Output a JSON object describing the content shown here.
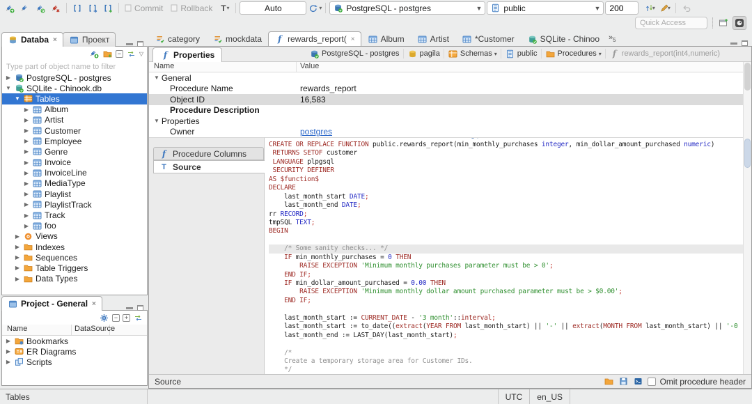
{
  "window": {
    "quick_access_placeholder": "Quick Access"
  },
  "toolbar": {
    "left_icons": [
      "new-connection-plug-icon",
      "connect-plug-icon",
      "reconnect-plug-icon",
      "disconnect-plug-icon",
      "|",
      "sql-editor-icon",
      "recent-sql-editor-icon",
      "new-sql-editor-icon",
      "|"
    ],
    "commit": "Commit",
    "rollback": "Rollback",
    "tx_log": "T",
    "tx_mode": "Auto",
    "connection": "PostgreSQL - postgres",
    "schema": "public",
    "row_limit": "200",
    "right_icons": [
      "fetch-size-sync-icon",
      "brush-icon",
      "|",
      "undo-icon"
    ]
  },
  "navigator": {
    "tab_database": "Databa",
    "tab_project": "Проект",
    "filter_placeholder": "Type part of object name to filter",
    "tree": [
      {
        "indent": 0,
        "exp": "collapsed",
        "icon": "postgres-db-icon",
        "label": "PostgreSQL - postgres"
      },
      {
        "indent": 0,
        "exp": "expanded",
        "icon": "sqlite-db-icon",
        "label": "SQLite - Chinook.db"
      },
      {
        "indent": 1,
        "exp": "expanded",
        "icon": "tables-folder-icon",
        "label": "Tables",
        "selected": true
      },
      {
        "indent": 2,
        "exp": "collapsed",
        "icon": "table-icon",
        "label": "Album"
      },
      {
        "indent": 2,
        "exp": "collapsed",
        "icon": "table-icon",
        "label": "Artist"
      },
      {
        "indent": 2,
        "exp": "collapsed",
        "icon": "table-icon",
        "label": "Customer"
      },
      {
        "indent": 2,
        "exp": "collapsed",
        "icon": "table-icon",
        "label": "Employee"
      },
      {
        "indent": 2,
        "exp": "collapsed",
        "icon": "table-icon",
        "label": "Genre"
      },
      {
        "indent": 2,
        "exp": "collapsed",
        "icon": "table-icon",
        "label": "Invoice"
      },
      {
        "indent": 2,
        "exp": "collapsed",
        "icon": "table-icon",
        "label": "InvoiceLine"
      },
      {
        "indent": 2,
        "exp": "collapsed",
        "icon": "table-icon",
        "label": "MediaType"
      },
      {
        "indent": 2,
        "exp": "collapsed",
        "icon": "table-icon",
        "label": "Playlist"
      },
      {
        "indent": 2,
        "exp": "collapsed",
        "icon": "table-icon",
        "label": "PlaylistTrack"
      },
      {
        "indent": 2,
        "exp": "collapsed",
        "icon": "table-icon",
        "label": "Track"
      },
      {
        "indent": 2,
        "exp": "collapsed",
        "icon": "table-icon",
        "label": "foo"
      },
      {
        "indent": 1,
        "exp": "collapsed",
        "icon": "views-icon",
        "label": "Views"
      },
      {
        "indent": 1,
        "exp": "collapsed",
        "icon": "folder-icon",
        "label": "Indexes"
      },
      {
        "indent": 1,
        "exp": "collapsed",
        "icon": "folder-icon",
        "label": "Sequences"
      },
      {
        "indent": 1,
        "exp": "collapsed",
        "icon": "folder-icon",
        "label": "Table Triggers"
      },
      {
        "indent": 1,
        "exp": "collapsed",
        "icon": "folder-icon",
        "label": "Data Types"
      }
    ]
  },
  "project_panel": {
    "title": "Project - General",
    "columns": [
      "Name",
      "DataSource"
    ],
    "tree": [
      {
        "indent": 0,
        "exp": "collapsed",
        "icon": "bookmarks-icon",
        "label": "Bookmarks"
      },
      {
        "indent": 0,
        "exp": "collapsed",
        "icon": "er-diagram-icon",
        "label": "ER Diagrams"
      },
      {
        "indent": 0,
        "exp": "collapsed",
        "icon": "scripts-icon",
        "label": "Scripts"
      }
    ]
  },
  "editor": {
    "tabs": [
      {
        "icon": "sql-script-icon",
        "label": "category"
      },
      {
        "icon": "sql-script-icon",
        "label": "mockdata"
      },
      {
        "icon": "function-icon",
        "label": "rewards_report(",
        "active": true,
        "closable": true
      },
      {
        "icon": "table-icon",
        "label": "Album"
      },
      {
        "icon": "table-icon",
        "label": "Artist"
      },
      {
        "icon": "table-icon",
        "label": "*Customer"
      },
      {
        "icon": "sqlite-db-icon",
        "label": "SQLite - Chinoo"
      }
    ],
    "hidden_tabs_count": "5",
    "properties_tab": "Properties",
    "breadcrumb": [
      {
        "icon": "postgres-db-icon",
        "label": "PostgreSQL - postgres"
      },
      {
        "icon": "db-icon",
        "label": "pagila"
      },
      {
        "icon": "schemas-icon",
        "label": "Schemas",
        "dropdown": true
      },
      {
        "icon": "schema-icon",
        "label": "public"
      },
      {
        "icon": "folder-icon",
        "label": "Procedures",
        "dropdown": true
      },
      {
        "icon": "function-icon",
        "label": "rewards_report(int4,numeric)",
        "dim": true
      }
    ],
    "properties_grid": {
      "name_header": "Name",
      "value_header": "Value",
      "rows": [
        {
          "indent": 0,
          "exp": "expanded",
          "label": "General",
          "value": ""
        },
        {
          "indent": 1,
          "label": "Procedure Name",
          "value": "rewards_report"
        },
        {
          "indent": 1,
          "label": "Object ID",
          "value": "16,583",
          "highlighted": true
        },
        {
          "indent": 1,
          "label": "Procedure Description",
          "value": "",
          "bold": true
        },
        {
          "indent": 0,
          "exp": "expanded",
          "label": "Properties",
          "value": ""
        },
        {
          "indent": 1,
          "label": "Owner",
          "value": "postgres",
          "link": true
        }
      ]
    },
    "side_tabs": [
      {
        "icon": "function-icon",
        "label": "Procedure Columns"
      },
      {
        "icon": "source-icon",
        "label": "Source",
        "active": true
      }
    ],
    "footer_label": "Source",
    "omit_header_label": "Omit procedure header"
  },
  "statusbar": {
    "left": "Tables",
    "timezone": "UTC",
    "locale": "en_US"
  },
  "source_code": {
    "current_line": 12,
    "lines": [
      [
        [
          "k",
          "CREATE OR REPLACE FUNCTION "
        ],
        [
          "p",
          "public.rewards_report(min_monthly_purchases "
        ],
        [
          "t",
          "integer"
        ],
        [
          "p",
          ", min_dollar_amount_purchased "
        ],
        [
          "t",
          "numeric"
        ],
        [
          "p",
          ")"
        ]
      ],
      [
        [
          "p",
          " "
        ],
        [
          "k",
          "RETURNS SETOF "
        ],
        [
          "p",
          "customer"
        ]
      ],
      [
        [
          "p",
          " "
        ],
        [
          "k",
          "LANGUAGE "
        ],
        [
          "p",
          "plpgsql"
        ]
      ],
      [
        [
          "p",
          " "
        ],
        [
          "k",
          "SECURITY DEFINER"
        ]
      ],
      [
        [
          "k",
          "AS $function$"
        ]
      ],
      [
        [
          "k",
          "DECLARE"
        ]
      ],
      [
        [
          "p",
          "    last_month_start "
        ],
        [
          "t",
          "DATE"
        ],
        [
          "r",
          ";"
        ]
      ],
      [
        [
          "p",
          "    last_month_end "
        ],
        [
          "t",
          "DATE"
        ],
        [
          "r",
          ";"
        ]
      ],
      [
        [
          "p",
          "rr "
        ],
        [
          "t",
          "RECORD"
        ],
        [
          "r",
          ";"
        ]
      ],
      [
        [
          "p",
          "tmpSQL "
        ],
        [
          "t",
          "TEXT"
        ],
        [
          "r",
          ";"
        ]
      ],
      [
        [
          "k",
          "BEGIN"
        ]
      ],
      [],
      [
        [
          "c",
          "    /* Some sanity checks... */"
        ]
      ],
      [
        [
          "p",
          "    "
        ],
        [
          "k",
          "IF"
        ],
        [
          "p",
          " min_monthly_purchases = "
        ],
        [
          "n",
          "0"
        ],
        [
          "p",
          " "
        ],
        [
          "k",
          "THEN"
        ]
      ],
      [
        [
          "p",
          "        "
        ],
        [
          "k",
          "RAISE EXCEPTION "
        ],
        [
          "s",
          "'Minimum monthly purchases parameter must be > 0'"
        ],
        [
          "r",
          ";"
        ]
      ],
      [
        [
          "p",
          "    "
        ],
        [
          "k",
          "END IF"
        ],
        [
          "r",
          ";"
        ]
      ],
      [
        [
          "p",
          "    "
        ],
        [
          "k",
          "IF"
        ],
        [
          "p",
          " min_dollar_amount_purchased = "
        ],
        [
          "n",
          "0.00"
        ],
        [
          "p",
          " "
        ],
        [
          "k",
          "THEN"
        ]
      ],
      [
        [
          "p",
          "        "
        ],
        [
          "k",
          "RAISE EXCEPTION "
        ],
        [
          "s",
          "'Minimum monthly dollar amount purchased parameter must be > $0.00'"
        ],
        [
          "r",
          ";"
        ]
      ],
      [
        [
          "p",
          "    "
        ],
        [
          "k",
          "END IF"
        ],
        [
          "r",
          ";"
        ]
      ],
      [],
      [
        [
          "p",
          "    last_month_start := "
        ],
        [
          "k",
          "CURRENT_DATE"
        ],
        [
          "p",
          " - "
        ],
        [
          "s",
          "'3 month'"
        ],
        [
          "p",
          "::"
        ],
        [
          "k",
          "interval"
        ],
        [
          "r",
          ";"
        ]
      ],
      [
        [
          "p",
          "    last_month_start := to_date(("
        ],
        [
          "k",
          "extract"
        ],
        [
          "p",
          "("
        ],
        [
          "k",
          "YEAR FROM"
        ],
        [
          "p",
          " last_month_start) || "
        ],
        [
          "s",
          "'-'"
        ],
        [
          "p",
          " || "
        ],
        [
          "k",
          "extract"
        ],
        [
          "p",
          "("
        ],
        [
          "k",
          "MONTH FROM"
        ],
        [
          "p",
          " last_month_start) || "
        ],
        [
          "s",
          "'-0"
        ]
      ],
      [
        [
          "p",
          "    last_month_end := LAST_DAY(last_month_start)"
        ],
        [
          "r",
          ";"
        ]
      ],
      [],
      [
        [
          "c",
          "    /*"
        ]
      ],
      [
        [
          "c",
          "    Create a temporary storage area for Customer IDs."
        ]
      ],
      [
        [
          "c",
          "    */"
        ]
      ]
    ]
  }
}
